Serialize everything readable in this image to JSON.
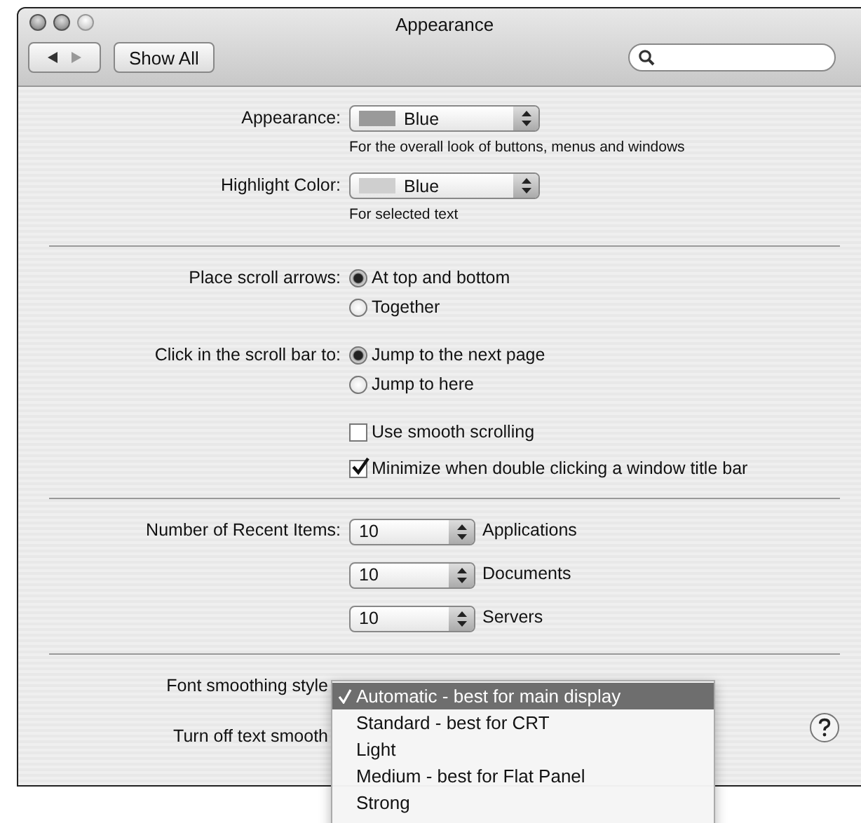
{
  "window": {
    "title": "Appearance"
  },
  "toolbar": {
    "show_all": "Show All"
  },
  "sections": [
    [
      {
        "kind": "popup",
        "label": "Appearance:",
        "value": "Blue",
        "caption": "For the overall look of buttons, menus and windows"
      },
      {
        "kind": "popup",
        "label": "Highlight Color:",
        "value": "Blue",
        "caption": "For selected text"
      }
    ],
    [
      {
        "kind": "radio",
        "label": "Place scroll arrows:",
        "options": [
          {
            "label": "At top and bottom",
            "selected": true
          },
          {
            "label": "Together",
            "selected": false
          }
        ]
      },
      {
        "kind": "radio",
        "label": "Click in the scroll bar to:",
        "options": [
          {
            "label": "Jump to the next page",
            "selected": true
          },
          {
            "label": "Jump to here",
            "selected": false
          }
        ]
      },
      {
        "kind": "checkbox",
        "label": "Use smooth scrolling",
        "checked": false
      },
      {
        "kind": "checkbox",
        "label": "Minimize when double clicking a window title bar",
        "checked": true
      }
    ],
    [
      {
        "kind": "count",
        "label": "Number of Recent Items:",
        "value": "10",
        "unit": "Applications"
      },
      {
        "kind": "count",
        "value": "10",
        "unit": "Documents"
      },
      {
        "kind": "count",
        "value": "10",
        "unit": "Servers"
      }
    ],
    [
      {
        "kind": "text",
        "label": "Font smoothing style"
      },
      {
        "kind": "text",
        "label": "Turn off text smooth"
      }
    ]
  ],
  "menu": {
    "items": [
      {
        "label": "Automatic - best for main display",
        "selected": true
      },
      {
        "label": "Standard - best for CRT",
        "selected": false
      },
      {
        "label": "Light",
        "selected": false
      },
      {
        "label": "Medium - best for Flat Panel",
        "selected": false
      },
      {
        "label": "Strong",
        "selected": false
      }
    ]
  }
}
